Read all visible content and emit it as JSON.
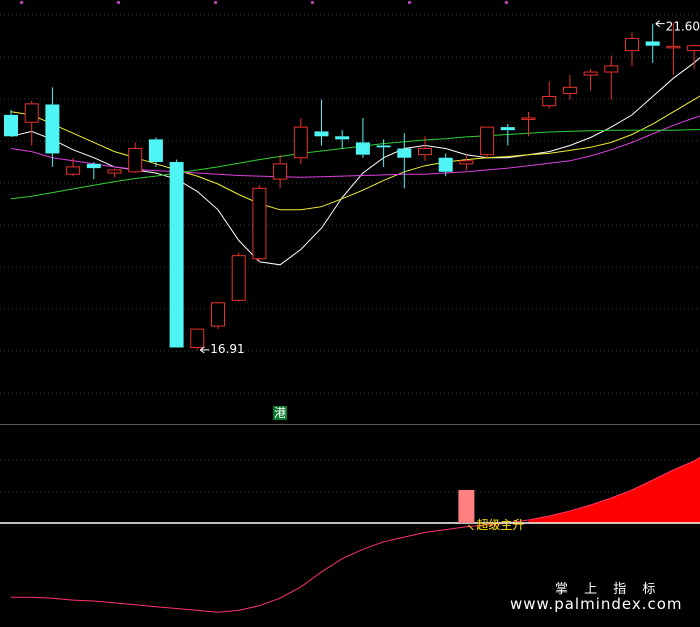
{
  "chart_data": {
    "type": "candlestick",
    "price_range": [
      15.7,
      22.3
    ],
    "candles": [
      {
        "o": 20.75,
        "h": 20.83,
        "l": 20.4,
        "c": 20.4
      },
      {
        "o": 20.63,
        "h": 20.98,
        "l": 20.25,
        "c": 20.93
      },
      {
        "o": 20.92,
        "h": 21.2,
        "l": 19.9,
        "c": 20.12
      },
      {
        "o": 19.78,
        "h": 20.05,
        "l": 19.75,
        "c": 19.9
      },
      {
        "o": 19.95,
        "h": 19.98,
        "l": 19.7,
        "c": 19.88
      },
      {
        "o": 19.8,
        "h": 19.87,
        "l": 19.73,
        "c": 19.85
      },
      {
        "o": 19.82,
        "h": 20.3,
        "l": 19.8,
        "c": 20.2
      },
      {
        "o": 20.35,
        "h": 20.38,
        "l": 19.9,
        "c": 19.98
      },
      {
        "o": 19.98,
        "h": 20.02,
        "l": 16.95,
        "c": 16.95
      },
      {
        "o": 16.95,
        "h": 17.25,
        "l": 16.91,
        "c": 17.25
      },
      {
        "o": 17.3,
        "h": 17.7,
        "l": 17.25,
        "c": 17.68
      },
      {
        "o": 17.72,
        "h": 18.5,
        "l": 17.7,
        "c": 18.45
      },
      {
        "o": 18.4,
        "h": 19.6,
        "l": 18.35,
        "c": 19.55
      },
      {
        "o": 19.7,
        "h": 20.1,
        "l": 19.55,
        "c": 19.95
      },
      {
        "o": 20.05,
        "h": 20.7,
        "l": 19.95,
        "c": 20.55
      },
      {
        "o": 20.48,
        "h": 21.0,
        "l": 20.25,
        "c": 20.4
      },
      {
        "o": 20.4,
        "h": 20.5,
        "l": 20.2,
        "c": 20.35
      },
      {
        "o": 20.3,
        "h": 20.7,
        "l": 20.05,
        "c": 20.1
      },
      {
        "o": 20.25,
        "h": 20.35,
        "l": 19.9,
        "c": 20.22
      },
      {
        "o": 20.2,
        "h": 20.45,
        "l": 19.55,
        "c": 20.05
      },
      {
        "o": 20.1,
        "h": 20.4,
        "l": 20.0,
        "c": 20.2
      },
      {
        "o": 20.05,
        "h": 20.12,
        "l": 19.75,
        "c": 19.82
      },
      {
        "o": 19.95,
        "h": 20.1,
        "l": 19.85,
        "c": 20.0
      },
      {
        "o": 20.1,
        "h": 20.55,
        "l": 20.05,
        "c": 20.55
      },
      {
        "o": 20.55,
        "h": 20.6,
        "l": 20.25,
        "c": 20.5
      },
      {
        "o": 20.7,
        "h": 20.8,
        "l": 20.4,
        "c": 20.7
      },
      {
        "o": 20.9,
        "h": 21.3,
        "l": 20.85,
        "c": 21.05
      },
      {
        "o": 21.1,
        "h": 21.4,
        "l": 21.0,
        "c": 21.2
      },
      {
        "o": 21.4,
        "h": 21.5,
        "l": 21.15,
        "c": 21.45
      },
      {
        "o": 21.45,
        "h": 21.72,
        "l": 21.0,
        "c": 21.55
      },
      {
        "o": 21.8,
        "h": 22.1,
        "l": 21.55,
        "c": 22.0
      },
      {
        "o": 21.95,
        "h": 22.24,
        "l": 21.6,
        "c": 21.88
      },
      {
        "o": 21.85,
        "h": 22.25,
        "l": 21.4,
        "c": 21.87
      },
      {
        "o": 21.8,
        "h": 21.9,
        "l": 21.5,
        "c": 21.88
      },
      {
        "o": 21.95,
        "h": 22.3,
        "l": 21.85,
        "c": 22.25
      }
    ],
    "up_color": "#e8322e",
    "down_color": "#4ff5f5",
    "moving_averages": [
      {
        "color": "#ffffff",
        "values": [
          20.4,
          20.48,
          20.35,
          20.18,
          20.05,
          19.9,
          19.85,
          19.8,
          19.7,
          19.5,
          19.2,
          18.7,
          18.35,
          18.3,
          18.55,
          18.9,
          19.4,
          19.8,
          20.05,
          20.2,
          20.25,
          20.2,
          20.1,
          20.05,
          20.05,
          20.1,
          20.15,
          20.25,
          20.38,
          20.55,
          20.75,
          21.05,
          21.35,
          21.6,
          21.9
        ]
      },
      {
        "color": "#f0f030",
        "values": [
          20.8,
          20.75,
          20.6,
          20.45,
          20.3,
          20.15,
          20.05,
          19.95,
          19.85,
          19.75,
          19.62,
          19.45,
          19.3,
          19.2,
          19.2,
          19.25,
          19.38,
          19.52,
          19.68,
          19.82,
          19.92,
          19.98,
          20.02,
          20.05,
          20.07,
          20.1,
          20.12,
          20.17,
          20.22,
          20.3,
          20.43,
          20.6,
          20.8,
          21.0,
          21.2
        ]
      },
      {
        "color": "#e040e0",
        "values": [
          20.2,
          20.15,
          20.05,
          20.0,
          19.95,
          19.9,
          19.86,
          19.84,
          19.82,
          19.8,
          19.78,
          19.76,
          19.75,
          19.74,
          19.73,
          19.74,
          19.75,
          19.76,
          19.77,
          19.78,
          19.78,
          19.8,
          19.82,
          19.85,
          19.88,
          19.92,
          19.96,
          20.0,
          20.08,
          20.18,
          20.3,
          20.44,
          20.58,
          20.7,
          20.8
        ]
      },
      {
        "color": "#30d030",
        "values": [
          19.38,
          19.42,
          19.48,
          19.54,
          19.6,
          19.66,
          19.71,
          19.75,
          19.8,
          19.85,
          19.9,
          19.96,
          20.02,
          20.07,
          20.12,
          20.16,
          20.2,
          20.24,
          20.28,
          20.31,
          20.34,
          20.36,
          20.39,
          20.41,
          20.43,
          20.45,
          20.47,
          20.48,
          20.49,
          20.5,
          20.5,
          20.5,
          20.5,
          20.51,
          20.51
        ]
      }
    ],
    "annotations": [
      {
        "text": "21.60",
        "candle": 31,
        "price": 22.24,
        "color": "#ffffff"
      },
      {
        "text": "16.91",
        "candle": 9,
        "price": 16.91,
        "color": "#ffffff"
      },
      {
        "text": "港",
        "candle": 13,
        "color": "#ffffff",
        "bg": "#0a7a2a"
      }
    ],
    "sub_indicator": {
      "zero_line_color": "#ffffff",
      "area_color": "#ff0000",
      "line_color": "#ff3366",
      "range": [
        -1.0,
        0.78
      ],
      "values": [
        -0.79,
        -0.79,
        -0.8,
        -0.82,
        -0.83,
        -0.85,
        -0.87,
        -0.89,
        -0.91,
        -0.93,
        -0.95,
        -0.93,
        -0.88,
        -0.8,
        -0.68,
        -0.52,
        -0.38,
        -0.28,
        -0.2,
        -0.15,
        -0.1,
        -0.07,
        -0.04,
        -0.02,
        0.0,
        0.03,
        0.07,
        0.12,
        0.18,
        0.25,
        0.33,
        0.43,
        0.53,
        0.62,
        0.75
      ],
      "signal_bar": {
        "candle": 22,
        "value": 0.33,
        "color": "#ff8080"
      },
      "signal_label": "超级主升",
      "signal_label_color": "#ffe000"
    }
  },
  "watermark": {
    "line1": "掌 上 指 标",
    "line2": "www.palmindex.com"
  }
}
